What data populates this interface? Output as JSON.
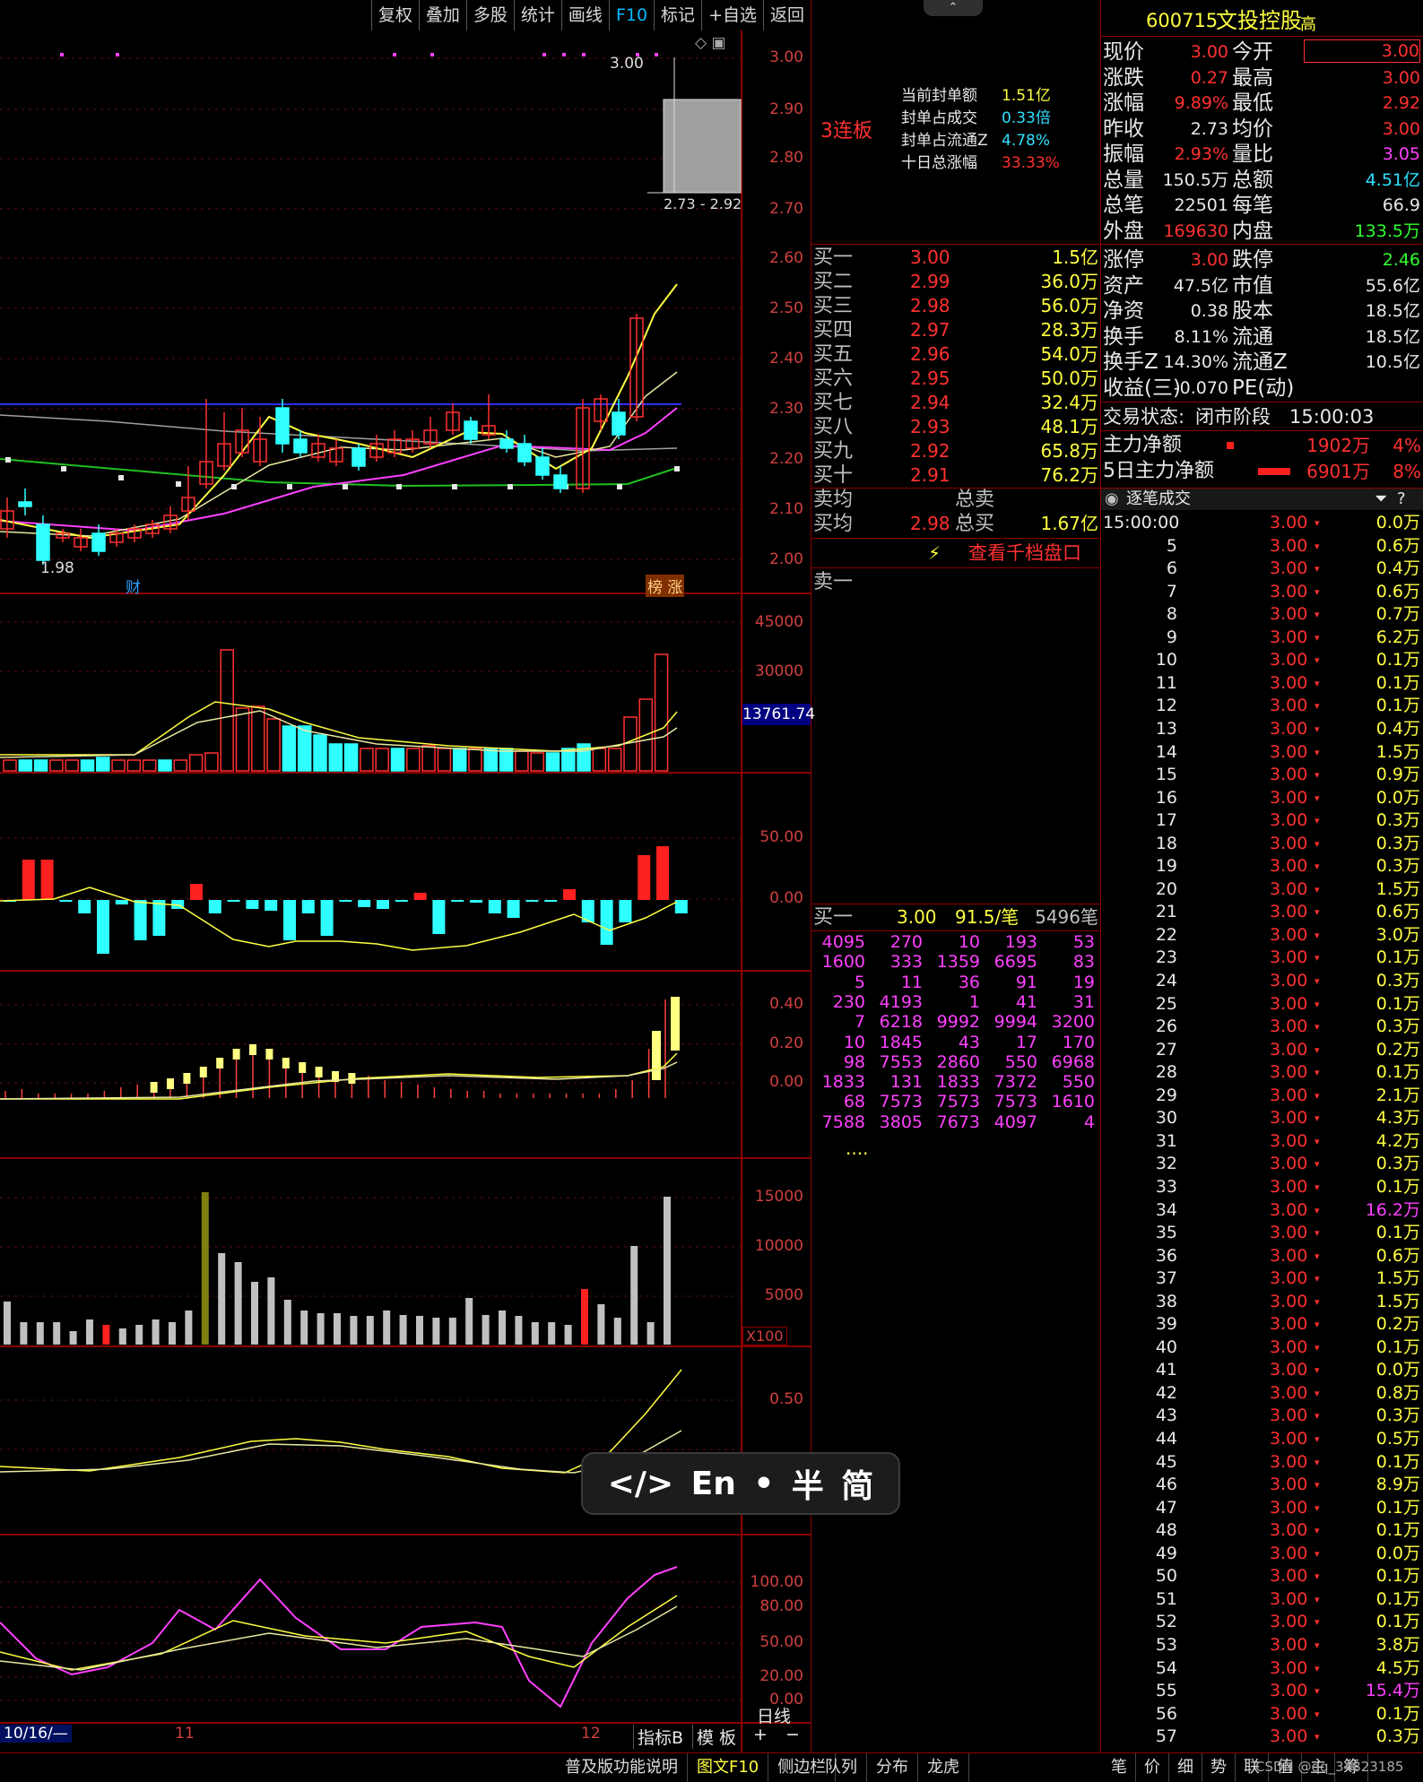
{
  "toolbar": {
    "items": [
      "复权",
      "叠加",
      "多股",
      "统计",
      "画线",
      "F10",
      "标记",
      "+自选",
      "返回"
    ]
  },
  "chart": {
    "main_ticks": [
      "3.00",
      "2.90",
      "2.80",
      "2.70",
      "2.60",
      "2.50",
      "2.40",
      "2.30",
      "2.20",
      "2.10",
      "2.00"
    ],
    "peak_label": "3.00",
    "low_label": "1.98",
    "range_label": "2.73 - 2.92",
    "tag_cai": "财",
    "tag_bangzhang": "榜 涨",
    "vol_ticks": [
      "45000",
      "30000"
    ],
    "vol_current": "13761.74",
    "macd_ticks": [
      "50.00",
      "0.00"
    ],
    "ind3_ticks": [
      "0.40",
      "0.20",
      "0.00"
    ],
    "ind4_ticks": [
      "15000",
      "10000",
      "5000"
    ],
    "ind4_unit": "X100",
    "ind5_ticks": [
      "0.50"
    ],
    "kdj_ticks": [
      "100.00",
      "80.00",
      "50.00",
      "20.00",
      "0.00"
    ],
    "date_start": "10/16/—",
    "date_11": "11",
    "date_12": "12",
    "bottom_zhibiao": "指标B",
    "bottom_muban": "模 板",
    "bottom_plus": "+",
    "bottom_minus": "−",
    "period": "日线"
  },
  "seal": {
    "lianban": "3连板",
    "lines": [
      {
        "label": "当前封单额",
        "value": "1.51亿"
      },
      {
        "label": "封单占成交",
        "value": "0.33倍"
      },
      {
        "label": "封单占流通Z",
        "value": "4.78%"
      },
      {
        "label": "十日总涨幅",
        "value": "33.33%"
      }
    ]
  },
  "bids": [
    {
      "label": "买一",
      "price": "3.00",
      "vol": "1.5亿"
    },
    {
      "label": "买二",
      "price": "2.99",
      "vol": "36.0万"
    },
    {
      "label": "买三",
      "price": "2.98",
      "vol": "56.0万"
    },
    {
      "label": "买四",
      "price": "2.97",
      "vol": "28.3万"
    },
    {
      "label": "买五",
      "price": "2.96",
      "vol": "54.0万"
    },
    {
      "label": "买六",
      "price": "2.95",
      "vol": "50.0万"
    },
    {
      "label": "买七",
      "price": "2.94",
      "vol": "32.4万"
    },
    {
      "label": "买八",
      "price": "2.93",
      "vol": "48.1万"
    },
    {
      "label": "买九",
      "price": "2.92",
      "vol": "65.8万"
    },
    {
      "label": "买十",
      "price": "2.91",
      "vol": "76.2万"
    }
  ],
  "avg": {
    "sell_label": "卖均",
    "sell_total_label": "总卖",
    "buy_label": "买均",
    "buy_price": "2.98",
    "buy_total_label": "总买",
    "buy_total": "1.67亿"
  },
  "qiandang": "查看千档盘口",
  "sell1": "卖一",
  "queue": {
    "label": "买一",
    "price": "3.00",
    "per": "91.5/笔",
    "count": "5496笔",
    "rows": [
      [
        "4095",
        "270",
        "10",
        "193",
        "53"
      ],
      [
        "1600",
        "333",
        "1359",
        "6695",
        "83"
      ],
      [
        "5",
        "11",
        "36",
        "91",
        "19"
      ],
      [
        "230",
        "4193",
        "1",
        "41",
        "31"
      ],
      [
        "7",
        "6218",
        "9992",
        "9994",
        "3200"
      ],
      [
        "10",
        "1845",
        "43",
        "17",
        "170"
      ],
      [
        "98",
        "7553",
        "2860",
        "550",
        "6968"
      ],
      [
        "1833",
        "131",
        "1833",
        "7372",
        "550"
      ],
      [
        "68",
        "7573",
        "7573",
        "7573",
        "1610"
      ],
      [
        "7588",
        "3805",
        "7673",
        "4097",
        "4"
      ]
    ],
    "more": "...."
  },
  "stock": {
    "code": "600715",
    "name": "文投控股",
    "tag": "高"
  },
  "quote": [
    [
      "现价",
      "3.00",
      "今开",
      "3.00"
    ],
    [
      "涨跌",
      "0.27",
      "最高",
      "3.00"
    ],
    [
      "涨幅",
      "9.89%",
      "最低",
      "2.92"
    ],
    [
      "昨收",
      "2.73",
      "均价",
      "3.00"
    ],
    [
      "振幅",
      "2.93%",
      "量比",
      "3.05"
    ],
    [
      "总量",
      "150.5万",
      "总额",
      "4.51亿"
    ],
    [
      "总笔",
      "22501",
      "每笔",
      "66.9"
    ],
    [
      "外盘",
      "169630",
      "内盘",
      "133.5万"
    ]
  ],
  "fund": [
    [
      "涨停",
      "3.00",
      "跌停",
      "2.46"
    ],
    [
      "资产",
      "47.5亿",
      "市值",
      "55.6亿"
    ],
    [
      "净资",
      "0.38",
      "股本",
      "18.5亿"
    ],
    [
      "换手",
      "8.11%",
      "流通",
      "18.5亿"
    ],
    [
      "换手Z",
      "14.30%",
      "流通Z",
      "10.5亿"
    ],
    [
      "收益(三)",
      "-0.070",
      "PE(动)",
      ""
    ]
  ],
  "status": {
    "label": "交易状态:",
    "value": "闭市阶段",
    "time": "15:00:03"
  },
  "flow": [
    {
      "label": "主力净额",
      "value": "1902万",
      "pct": "4%"
    },
    {
      "label": "5日主力净额",
      "value": "6901万",
      "pct": "8%"
    }
  ],
  "ticks_title": "逐笔成交",
  "ticks": [
    [
      "15:00:00",
      "3.00",
      "0.0万"
    ],
    [
      "5",
      "3.00",
      "0.6万"
    ],
    [
      "6",
      "3.00",
      "0.4万"
    ],
    [
      "7",
      "3.00",
      "0.6万"
    ],
    [
      "8",
      "3.00",
      "0.7万"
    ],
    [
      "9",
      "3.00",
      "6.2万"
    ],
    [
      "10",
      "3.00",
      "0.1万"
    ],
    [
      "11",
      "3.00",
      "0.1万"
    ],
    [
      "12",
      "3.00",
      "0.1万"
    ],
    [
      "13",
      "3.00",
      "0.4万"
    ],
    [
      "14",
      "3.00",
      "1.5万"
    ],
    [
      "15",
      "3.00",
      "0.9万"
    ],
    [
      "16",
      "3.00",
      "0.0万"
    ],
    [
      "17",
      "3.00",
      "0.3万"
    ],
    [
      "18",
      "3.00",
      "0.3万"
    ],
    [
      "19",
      "3.00",
      "0.3万"
    ],
    [
      "20",
      "3.00",
      "1.5万"
    ],
    [
      "21",
      "3.00",
      "0.6万"
    ],
    [
      "22",
      "3.00",
      "3.0万"
    ],
    [
      "23",
      "3.00",
      "0.1万"
    ],
    [
      "24",
      "3.00",
      "0.3万"
    ],
    [
      "25",
      "3.00",
      "0.1万"
    ],
    [
      "26",
      "3.00",
      "0.3万"
    ],
    [
      "27",
      "3.00",
      "0.2万"
    ],
    [
      "28",
      "3.00",
      "0.1万"
    ],
    [
      "29",
      "3.00",
      "2.1万"
    ],
    [
      "30",
      "3.00",
      "4.3万"
    ],
    [
      "31",
      "3.00",
      "4.2万"
    ],
    [
      "32",
      "3.00",
      "0.3万"
    ],
    [
      "33",
      "3.00",
      "0.1万"
    ],
    [
      "34",
      "3.00",
      "16.2万"
    ],
    [
      "35",
      "3.00",
      "0.1万"
    ],
    [
      "36",
      "3.00",
      "0.6万"
    ],
    [
      "37",
      "3.00",
      "1.5万"
    ],
    [
      "38",
      "3.00",
      "1.5万"
    ],
    [
      "39",
      "3.00",
      "0.2万"
    ],
    [
      "40",
      "3.00",
      "0.1万"
    ],
    [
      "41",
      "3.00",
      "0.0万"
    ],
    [
      "42",
      "3.00",
      "0.8万"
    ],
    [
      "43",
      "3.00",
      "0.3万"
    ],
    [
      "44",
      "3.00",
      "0.5万"
    ],
    [
      "45",
      "3.00",
      "0.1万"
    ],
    [
      "46",
      "3.00",
      "8.9万"
    ],
    [
      "47",
      "3.00",
      "0.1万"
    ],
    [
      "48",
      "3.00",
      "0.1万"
    ],
    [
      "49",
      "3.00",
      "0.0万"
    ],
    [
      "50",
      "3.00",
      "0.1万"
    ],
    [
      "51",
      "3.00",
      "0.1万"
    ],
    [
      "52",
      "3.00",
      "0.1万"
    ],
    [
      "53",
      "3.00",
      "3.8万"
    ],
    [
      "54",
      "3.00",
      "4.5万"
    ],
    [
      "55",
      "3.00",
      "15.4万"
    ],
    [
      "56",
      "3.00",
      "0.1万"
    ],
    [
      "57",
      "3.00",
      "0.3万"
    ]
  ],
  "ime": {
    "code": "</>",
    "lang": "En",
    "dot": "•",
    "half": "半",
    "simp": "简"
  },
  "statusbar": {
    "tabs": [
      "普及版功能说明",
      "图文F10",
      "侧边栏"
    ],
    "tabs2": [
      "队列",
      "分布",
      "龙虎"
    ],
    "tabs3": [
      "笔",
      "价",
      "细",
      "势",
      "联",
      "值",
      "主",
      "筹"
    ],
    "watermark": "CSDN @qq_34823185"
  }
}
